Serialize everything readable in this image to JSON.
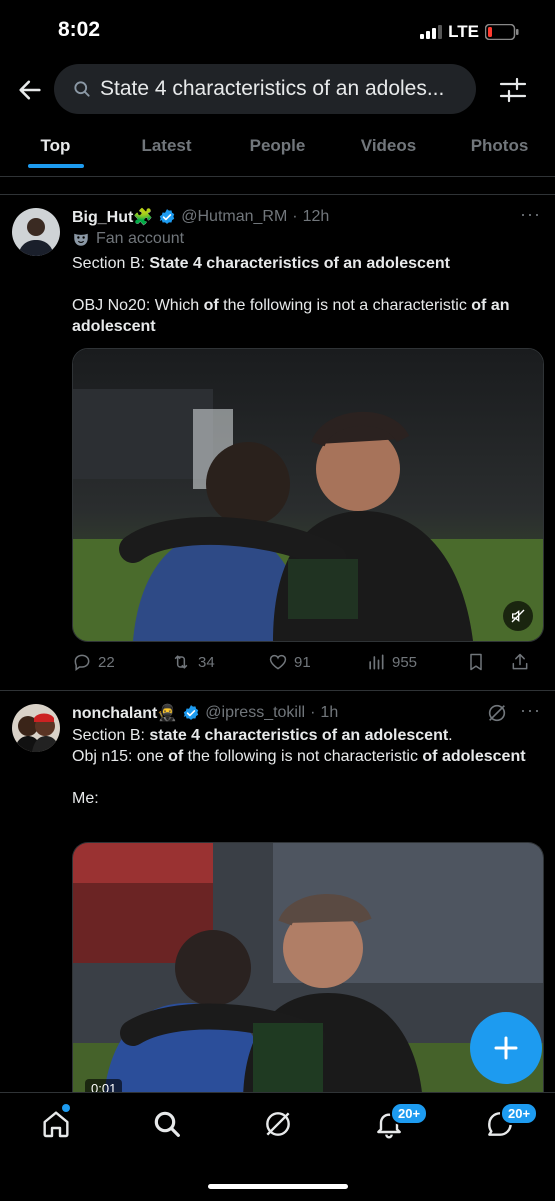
{
  "status_bar": {
    "time": "8:02",
    "network": "LTE"
  },
  "search": {
    "query": "State 4 characteristics of an adoles..."
  },
  "tabs": [
    {
      "label": "Top",
      "active": true
    },
    {
      "label": "Latest",
      "active": false
    },
    {
      "label": "People",
      "active": false
    },
    {
      "label": "Videos",
      "active": false
    },
    {
      "label": "Photos",
      "active": false
    }
  ],
  "tweets": [
    {
      "name": "Big_Hut🧩",
      "handle": "@Hutman_RM",
      "time": "12h",
      "label": "Fan account",
      "text_parts": [
        {
          "t": "Section B: ",
          "b": false
        },
        {
          "t": "State 4 characteristics of an adolescent",
          "b": true
        }
      ],
      "text2_parts": [
        {
          "t": "OBJ No20: Which ",
          "b": false
        },
        {
          "t": "of",
          "b": true
        },
        {
          "t": " the following is not a characteristic ",
          "b": false
        },
        {
          "t": "of an adolescent",
          "b": true
        }
      ],
      "stats": {
        "replies": "22",
        "retweets": "34",
        "likes": "91",
        "views": "955"
      }
    },
    {
      "name": "nonchalant🥷",
      "handle": "@ipress_tokill",
      "time": "1h",
      "text_parts": [
        {
          "t": "Section B: ",
          "b": false
        },
        {
          "t": "state 4 characteristics of an adolescent",
          "b": true
        },
        {
          "t": ".",
          "b": false
        }
      ],
      "text2_parts": [
        {
          "t": "Obj n15: one ",
          "b": false
        },
        {
          "t": "of",
          "b": true
        },
        {
          "t": " the following is not characteristic ",
          "b": false
        },
        {
          "t": "of adolescent",
          "b": true
        }
      ],
      "text3": "Me:",
      "video_time": "0:01"
    }
  ],
  "bottom_nav": {
    "notifications_badge": "20+",
    "messages_badge": "20+"
  },
  "colors": {
    "accent": "#1d9bf0",
    "background": "#000000",
    "muted": "#71767b"
  }
}
